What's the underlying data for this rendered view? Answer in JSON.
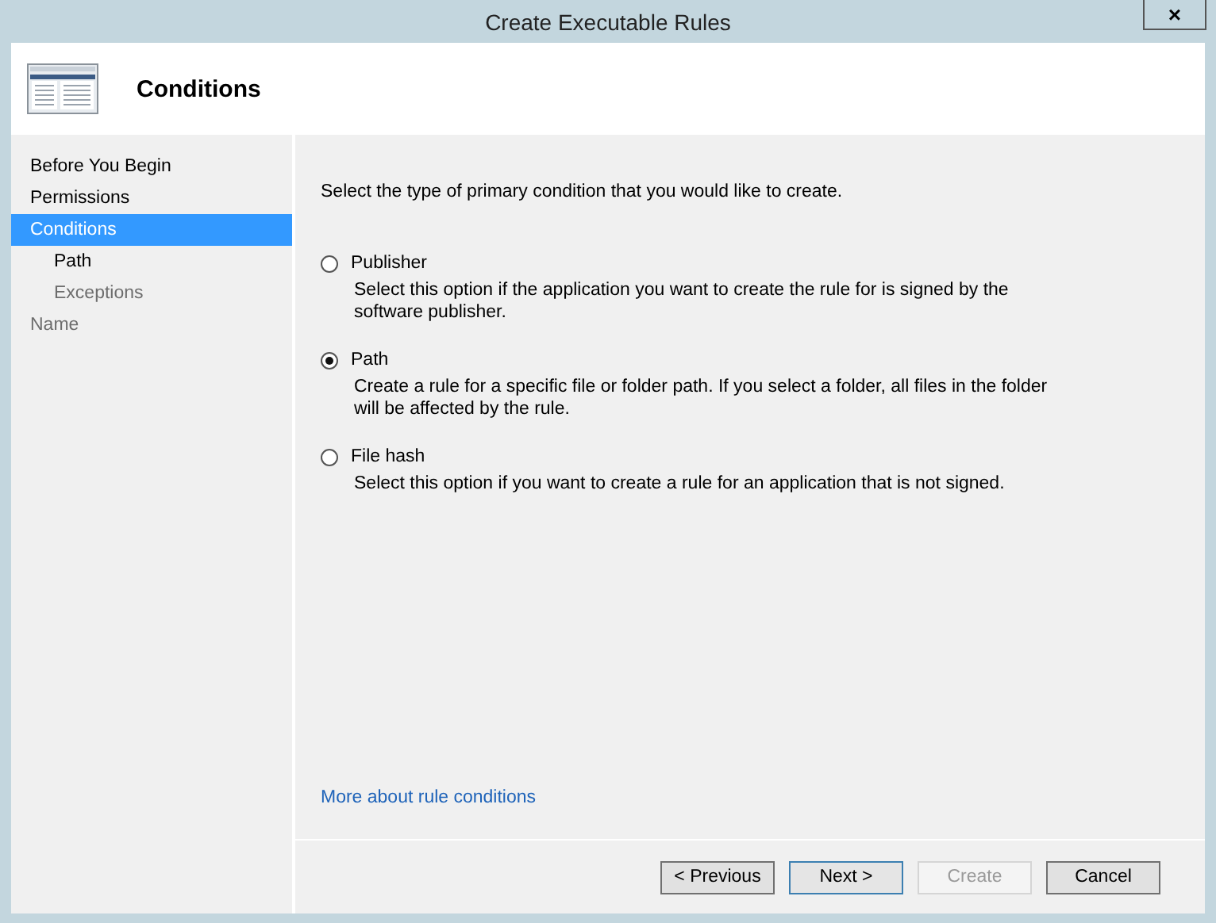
{
  "window": {
    "title": "Create Executable Rules",
    "close": "×"
  },
  "header": {
    "title": "Conditions"
  },
  "sidebar": {
    "items": [
      {
        "label": "Before You Begin",
        "selected": false,
        "disabled": false
      },
      {
        "label": "Permissions",
        "selected": false,
        "disabled": false
      },
      {
        "label": "Conditions",
        "selected": true,
        "disabled": false,
        "children": [
          {
            "label": "Path",
            "selected": false,
            "disabled": false
          },
          {
            "label": "Exceptions",
            "selected": false,
            "disabled": true
          }
        ]
      },
      {
        "label": "Name",
        "selected": false,
        "disabled": true
      }
    ]
  },
  "content": {
    "prompt": "Select the type of primary condition that you would like to create.",
    "options": [
      {
        "label": "Publisher",
        "selected": false,
        "description": "Select this option if the application you want to create the rule for is signed by the software publisher."
      },
      {
        "label": "Path",
        "selected": true,
        "description": "Create a rule for a specific file or folder path. If you select a folder, all files in the folder will be affected by the rule."
      },
      {
        "label": "File hash",
        "selected": false,
        "description": "Select this option if you want to create a rule for an application that is not signed."
      }
    ],
    "link": "More about rule conditions"
  },
  "buttons": [
    {
      "label": "< Previous",
      "default": false,
      "disabled": false
    },
    {
      "label": "Next >",
      "default": true,
      "disabled": false
    },
    {
      "label": "Create",
      "default": false,
      "disabled": true
    },
    {
      "label": "Cancel",
      "default": false,
      "disabled": false
    }
  ]
}
